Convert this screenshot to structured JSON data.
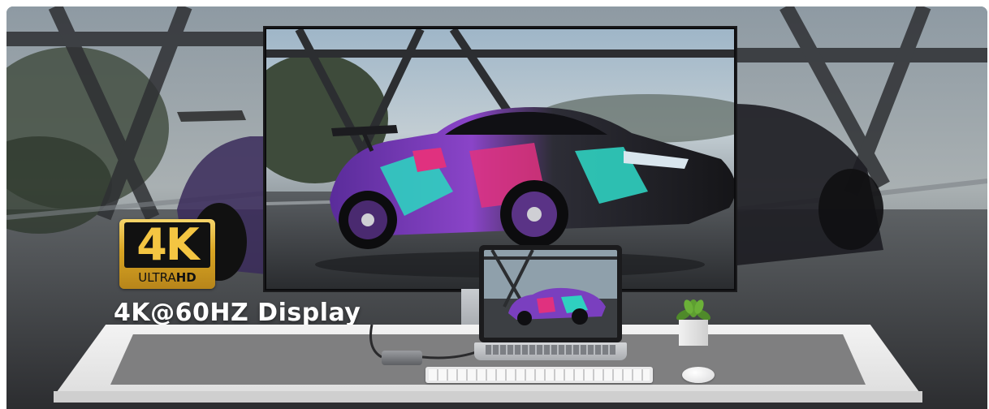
{
  "badge": {
    "main": "4K",
    "sub_light": "ULTRA",
    "sub_bold": "HD"
  },
  "headline": "4K@60HZ Display",
  "colors": {
    "badge_gold": "#d9a523",
    "badge_text": "#f4c542",
    "car_purple": "#7a3fbf",
    "car_teal": "#2fd0c0",
    "car_pink": "#e0317f"
  }
}
